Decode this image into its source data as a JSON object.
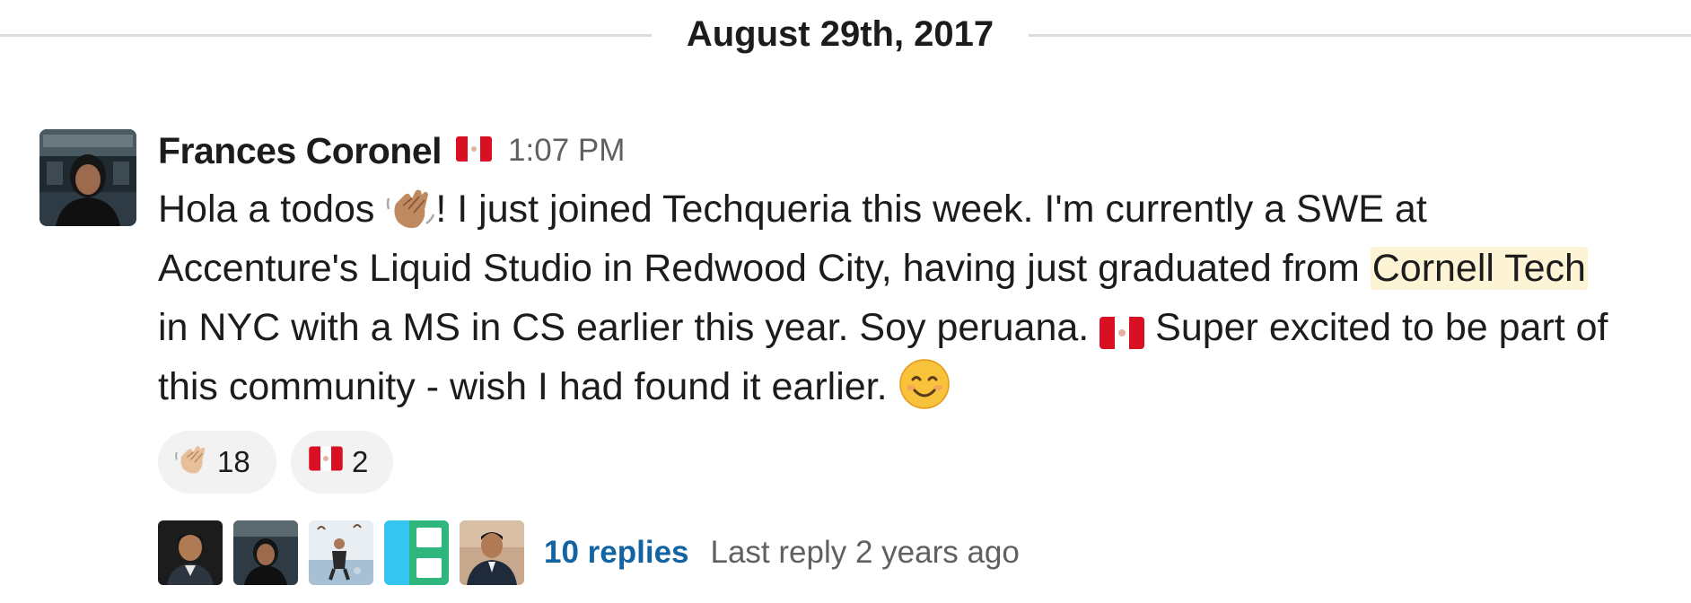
{
  "date_divider": {
    "label": "August 29th, 2017"
  },
  "message": {
    "author": "Frances Coronel",
    "author_flag_icon": "peru-flag-icon",
    "timestamp": "1:07 PM",
    "body": {
      "line1_a": "Hola a todos ",
      "line1_emoji": "waving-hand-emoji",
      "line1_b": "! I just joined Techqueria this week. I'm currently a SWE at",
      "line2_a": "Accenture's Liquid Studio in Redwood City, having just graduated from ",
      "line2_highlight": "Cornell Tech",
      "line3_a": "in NYC with a MS in CS earlier this year. Soy peruana. ",
      "line3_emoji": "peru-flag-emoji",
      "line3_b": " Super excited to be part of",
      "line4_a": "this community - wish I had found it earlier. ",
      "line4_emoji": "smiling-face-emoji"
    }
  },
  "reactions": [
    {
      "emoji": "waving-hand-emoji",
      "count": "18"
    },
    {
      "emoji": "peru-flag-emoji",
      "count": "2"
    }
  ],
  "thread": {
    "replies_label": "10 replies",
    "last_reply": "Last reply 2 years ago"
  },
  "colors": {
    "link": "#1264a3",
    "muted": "#616061",
    "highlight": "#fcf4d5",
    "reaction_bg": "#f2f2f2",
    "divider": "#dddddd"
  }
}
